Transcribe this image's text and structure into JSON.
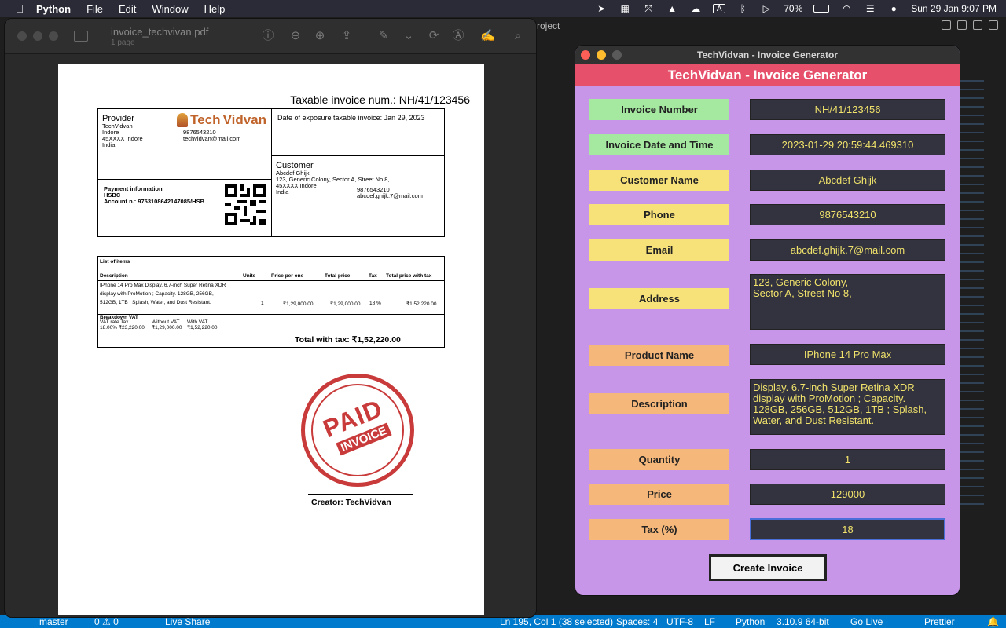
{
  "menubar": {
    "app": "Python",
    "items": [
      "File",
      "Edit",
      "Window",
      "Help"
    ],
    "battery": "70%",
    "clock": "Sun 29 Jan  9:07 PM",
    "input_source": "A"
  },
  "editor": {
    "project_label": "roject"
  },
  "statusbar": {
    "branch": "master",
    "problems": "0 ⚠ 0",
    "live_share": "Live Share",
    "cursor": "Ln 195, Col 1 (38 selected)",
    "spaces": "Spaces: 4",
    "encoding": "UTF-8",
    "eol": "LF",
    "language": "Python",
    "interpreter": "3.10.9 64-bit",
    "go_live": "Go Live",
    "prettier": "Prettier"
  },
  "preview": {
    "filename": "invoice_techvivan.pdf",
    "pages": "1 page",
    "pdf": {
      "invoice_title": "Taxable invoice num.: NH/41/123456",
      "provider_heading": "Provider",
      "provider_lines": [
        "TechVidvan",
        "Indore",
        "45XXXX Indore",
        "India"
      ],
      "provider_contact": [
        "9876543210",
        "techvidvan@mail.com"
      ],
      "logo_text": "Tech",
      "logo_text2": "Vidvan",
      "date_exposure": "Date of exposure taxable invoice: Jan 29, 2023",
      "payment_heading": "Payment information",
      "payment_bank": "HSBC",
      "payment_account": "Account n.: 9753108642147085/HSB",
      "customer_heading": "Customer",
      "customer_lines": [
        "Abcdef Ghijk",
        "123, Generic Colony, Sector A, Street No 8,",
        "45XXXX Indore",
        "India"
      ],
      "customer_contact": [
        "9876543210",
        "abcdef.ghijk.7@mail.com"
      ],
      "items_heading": "List of items",
      "columns": [
        "Description",
        "Units",
        "Price per one",
        "Total price",
        "Tax",
        "Total price with tax"
      ],
      "item_desc": [
        "IPhone 14 Pro Max Display. 6.7-inch Super Retina XDR",
        "display with ProMotion ; Capacity. 128GB, 256GB,",
        "512GB, 1TB ; Splash, Water, and Dust Resistant."
      ],
      "item_units": "1",
      "item_price": "₹1,29,000.00",
      "item_total": "₹1,29,000.00",
      "item_tax": "18 %",
      "item_total_tax": "₹1,52,220.00",
      "breakdown_heading": "Breakdown VAT",
      "breakdown_cols": [
        "VAT rate Tax",
        "Without VAT",
        "With VAT"
      ],
      "breakdown_vals": [
        "18.00%  ₹23,220.00",
        "₹1,29,000.00",
        "₹1,52,220.00"
      ],
      "total_with_tax": "Total with tax: ₹1,52,220.00",
      "stamp_top": "PAID",
      "stamp_bottom": "INVOICE",
      "creator": "Creator: TechVidvan"
    }
  },
  "tk": {
    "window_title": "TechVidvan - Invoice Generator",
    "banner": "TechVidvan - Invoice Generator",
    "fields": [
      {
        "label": "Invoice Number",
        "value": "NH/41/123456"
      },
      {
        "label": "Invoice Date and Time",
        "value": "2023-01-29 20:59:44.469310"
      },
      {
        "label": "Customer Name",
        "value": "Abcdef Ghijk"
      },
      {
        "label": "Phone",
        "value": "9876543210"
      },
      {
        "label": "Email",
        "value": "abcdef.ghijk.7@mail.com"
      },
      {
        "label": "Address",
        "value": "123, Generic Colony,\nSector A, Street No 8,"
      },
      {
        "label": "Product Name",
        "value": "IPhone 14 Pro Max"
      },
      {
        "label": "Description",
        "value": "Display. 6.7-inch Super Retina XDR display with ProMotion ; Capacity. 128GB, 256GB, 512GB, 1TB ; Splash, Water, and Dust Resistant."
      },
      {
        "label": "Quantity",
        "value": "1"
      },
      {
        "label": "Price",
        "value": "129000"
      },
      {
        "label": "Tax (%)",
        "value": "18"
      }
    ],
    "create_button": "Create Invoice",
    "colors": {
      "green": "#a5e8a0",
      "yellow": "#f7e27a",
      "orange": "#f5b77a",
      "value_text": "#f0e26a",
      "banner": "#e6506a",
      "bg": "#c896e8"
    }
  }
}
